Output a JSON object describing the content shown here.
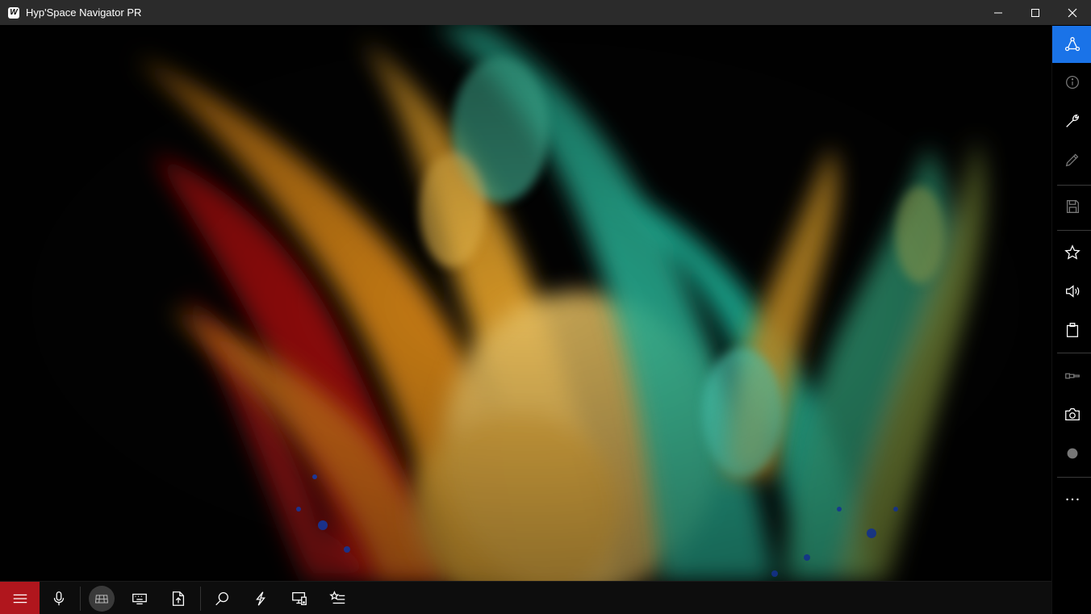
{
  "window": {
    "title": "Hyp'Space Navigator PR",
    "logo_letter": "W",
    "controls": [
      "minimize-icon",
      "maximize-icon",
      "close-icon"
    ]
  },
  "sidebar": {
    "items": [
      {
        "name": "network-icon",
        "active": true
      },
      {
        "name": "info-icon",
        "active": false
      },
      {
        "name": "wrench-icon",
        "active": false
      },
      {
        "name": "pencil-icon",
        "active": false
      },
      {
        "name": "save-icon",
        "active": false
      },
      {
        "name": "star-icon",
        "active": false
      },
      {
        "name": "volume-icon",
        "active": false
      },
      {
        "name": "clipboard-icon",
        "active": false
      },
      {
        "name": "flashlight-icon",
        "active": false
      },
      {
        "name": "camera-icon",
        "active": false
      },
      {
        "name": "record-icon",
        "active": false
      },
      {
        "name": "more-icon",
        "active": false
      }
    ],
    "more_label": "...",
    "accent": "#1a73e8"
  },
  "toolbar": {
    "items": [
      {
        "name": "menu-icon"
      },
      {
        "name": "microphone-icon"
      },
      {
        "name": "grid-icon"
      },
      {
        "name": "keyboard-icon"
      },
      {
        "name": "export-icon"
      },
      {
        "name": "search-icon"
      },
      {
        "name": "lightning-icon"
      },
      {
        "name": "devices-icon"
      },
      {
        "name": "favorites-list-icon"
      }
    ],
    "menu_color": "#b0161d"
  },
  "content": {
    "background": "color powder explosion image"
  }
}
